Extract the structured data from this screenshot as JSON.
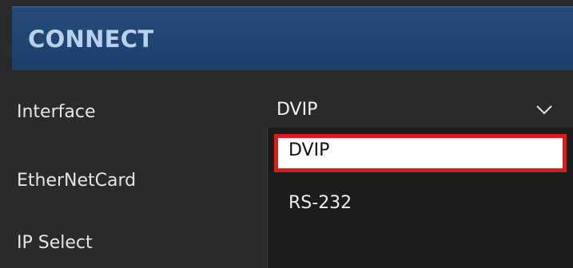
{
  "header": {
    "title": "CONNECT"
  },
  "form": {
    "interface_label": "Interface",
    "ethernet_label": "EtherNetCard",
    "ip_select_label": "IP Select"
  },
  "interface_select": {
    "value": "DVIP",
    "icon": "chevron-down-icon",
    "options": [
      {
        "label": "DVIP",
        "selected": true
      },
      {
        "label": "RS-232",
        "selected": false
      }
    ]
  },
  "colors": {
    "header_bg": "#1f4573",
    "header_text": "#b8d0ec",
    "panel_bg": "#2a2a2a",
    "dropdown_bg": "#1c1c1c",
    "highlight_border": "#e01b1b"
  }
}
